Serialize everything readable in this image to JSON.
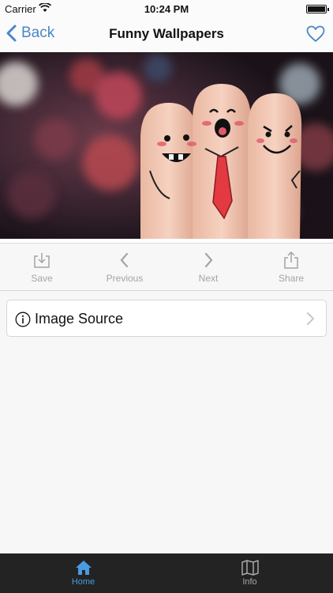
{
  "status_bar": {
    "carrier": "Carrier",
    "time": "10:24 PM"
  },
  "nav": {
    "back_label": "Back",
    "title": "Funny Wallpapers"
  },
  "toolbar": {
    "save_label": "Save",
    "previous_label": "Previous",
    "next_label": "Next",
    "share_label": "Share"
  },
  "source_row": {
    "label": "Image Source"
  },
  "tab_bar": {
    "home_label": "Home",
    "info_label": "Info"
  },
  "colors": {
    "accent": "#4a86c8",
    "tab_active": "#4a9be0",
    "tab_bar_bg": "#232323",
    "toolbar_disabled": "#a4a4a4"
  },
  "icons": [
    "wifi-icon",
    "battery-icon",
    "chevron-left-icon",
    "heart-icon",
    "save-icon",
    "previous-icon",
    "next-icon",
    "share-icon",
    "info-icon",
    "chevron-right-icon",
    "home-icon",
    "map-icon"
  ]
}
